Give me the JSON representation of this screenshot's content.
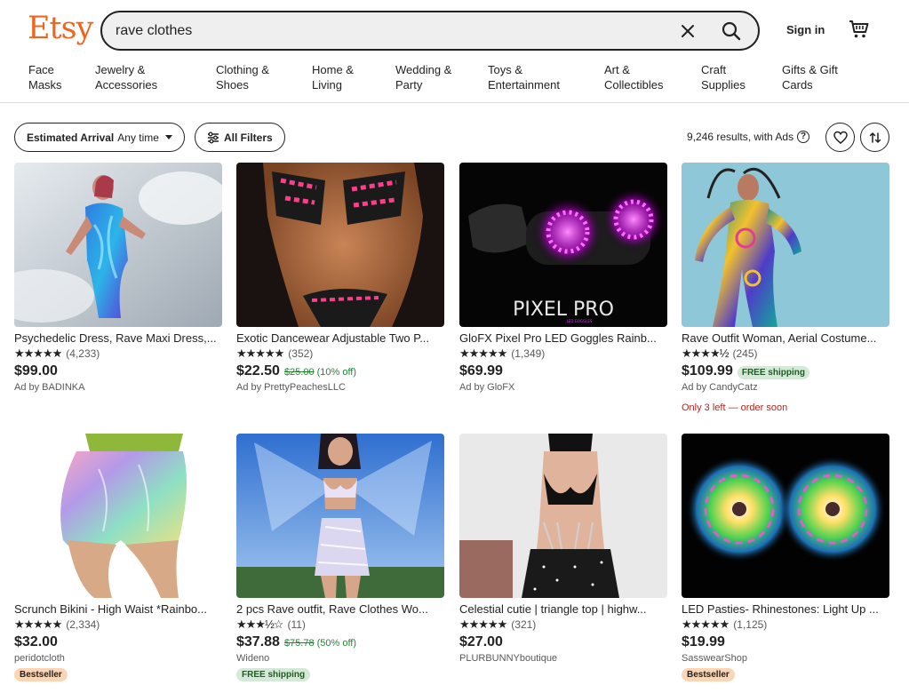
{
  "header": {
    "logo": "Etsy",
    "search_value": "rave clothes",
    "signin": "Sign in",
    "categories": [
      {
        "line1": "Face",
        "line2": "Masks"
      },
      {
        "line1": "Jewelry &",
        "line2": "Accessories"
      },
      {
        "line1": "Clothing &",
        "line2": "Shoes"
      },
      {
        "line1": "Home &",
        "line2": "Living"
      },
      {
        "line1": "Wedding &",
        "line2": "Party"
      },
      {
        "line1": "Toys &",
        "line2": "Entertainment"
      },
      {
        "line1": "Art &",
        "line2": "Collectibles"
      },
      {
        "line1": "Craft",
        "line2": "Supplies"
      },
      {
        "line1": "Gifts & Gift",
        "line2": "Cards"
      }
    ]
  },
  "filters": {
    "arrival_label": "Estimated Arrival",
    "arrival_value": "Any time",
    "all_filters": "All Filters",
    "results": "9,246 results, with Ads",
    "help": "?"
  },
  "products": [
    {
      "title": "Psychedelic Dress, Rave Maxi Dress,...",
      "stars": "★★★★★",
      "count": "(4,233)",
      "price": "$99.00",
      "original": "",
      "discount": "",
      "shipping": "",
      "shop": "Ad by BADINKA",
      "scarcity": "",
      "badge": ""
    },
    {
      "title": "Exotic Dancewear Adjustable Two P...",
      "stars": "★★★★★",
      "count": "(352)",
      "price": "$22.50",
      "original": "$25.00",
      "discount": "(10% off)",
      "shipping": "",
      "shop": "Ad by PrettyPeachesLLC",
      "scarcity": "",
      "badge": ""
    },
    {
      "title": "GloFX Pixel Pro LED Goggles Rainb...",
      "stars": "★★★★★",
      "count": "(1,349)",
      "price": "$69.99",
      "original": "",
      "discount": "",
      "shipping": "",
      "shop": "Ad by GloFX",
      "scarcity": "",
      "badge": "",
      "image_text": "PIXEL PRO",
      "image_subtext": "LED GOGGLES"
    },
    {
      "title": "Rave Outfit Woman, Aerial Costume...",
      "stars": "★★★★½",
      "count": "(245)",
      "price": "$109.99",
      "original": "",
      "discount": "",
      "shipping": "FREE shipping",
      "shop": "Ad by CandyCatz",
      "scarcity": "Only 3 left — order soon",
      "badge": ""
    },
    {
      "title": "Scrunch Bikini - High Waist *Rainbo...",
      "stars": "★★★★★",
      "count": "(2,334)",
      "price": "$32.00",
      "original": "",
      "discount": "",
      "shipping": "",
      "shop": "peridotcloth",
      "scarcity": "",
      "badge": "Bestseller"
    },
    {
      "title": "2 pcs Rave outfit, Rave Clothes Wo...",
      "stars": "★★★½☆",
      "count": "(11)",
      "price": "$37.88",
      "original": "$75.78",
      "discount": "(50% off)",
      "shipping": "",
      "shop": "Wideno",
      "scarcity": "",
      "badge": "FREE shipping"
    },
    {
      "title": "Celestial cutie | triangle top | highw...",
      "stars": "★★★★★",
      "count": "(321)",
      "price": "$27.00",
      "original": "",
      "discount": "",
      "shipping": "",
      "shop": "PLURBUNNYboutique",
      "scarcity": "",
      "badge": ""
    },
    {
      "title": "LED Pasties- Rhinestones: Light Up ...",
      "stars": "★★★★★",
      "count": "(1,125)",
      "price": "$19.99",
      "original": "",
      "discount": "",
      "shipping": "",
      "shop": "SasswearShop",
      "scarcity": "",
      "badge": "Bestseller"
    }
  ],
  "colors": {
    "brand": "#f1641e",
    "sale_green": "#258635",
    "scarcity_red": "#b3261e"
  }
}
